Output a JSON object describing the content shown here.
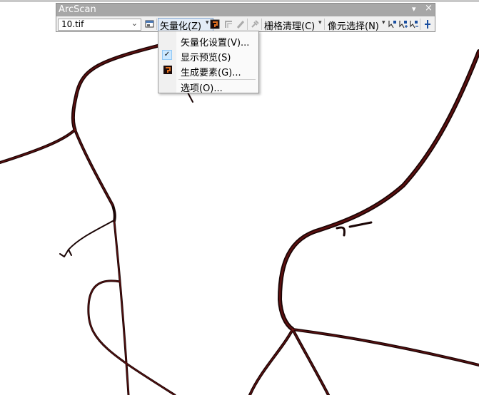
{
  "window": {
    "title": "ArcScan",
    "pin_glyph": "▾",
    "close_glyph": "×"
  },
  "toolbar": {
    "raster_layer": "10.tif",
    "vectorization_label": "矢量化(Z)",
    "raster_cleanup_label": "栅格清理(C)",
    "cell_selection_label": "像元选择(N)"
  },
  "menu": {
    "items": [
      {
        "label": "矢量化设置(V)..."
      },
      {
        "label": "显示预览(S)",
        "checked": true
      },
      {
        "label": "生成要素(G)..."
      },
      {
        "label": "选项(O)..."
      }
    ]
  },
  "icons": [
    "layout-icon",
    "generate-features-icon",
    "line-tool-icon",
    "pencil-icon",
    "pin-icon",
    "select-connected-cells-icon",
    "add-cells-icon",
    "cell-selection-plus-icon",
    "find-cells-icon"
  ],
  "colors": {
    "road_stroke": "#6b1010",
    "title_bar": "#a7a7a7",
    "menu_check": "#cce8ff",
    "hover_border": "#7da2ce"
  }
}
